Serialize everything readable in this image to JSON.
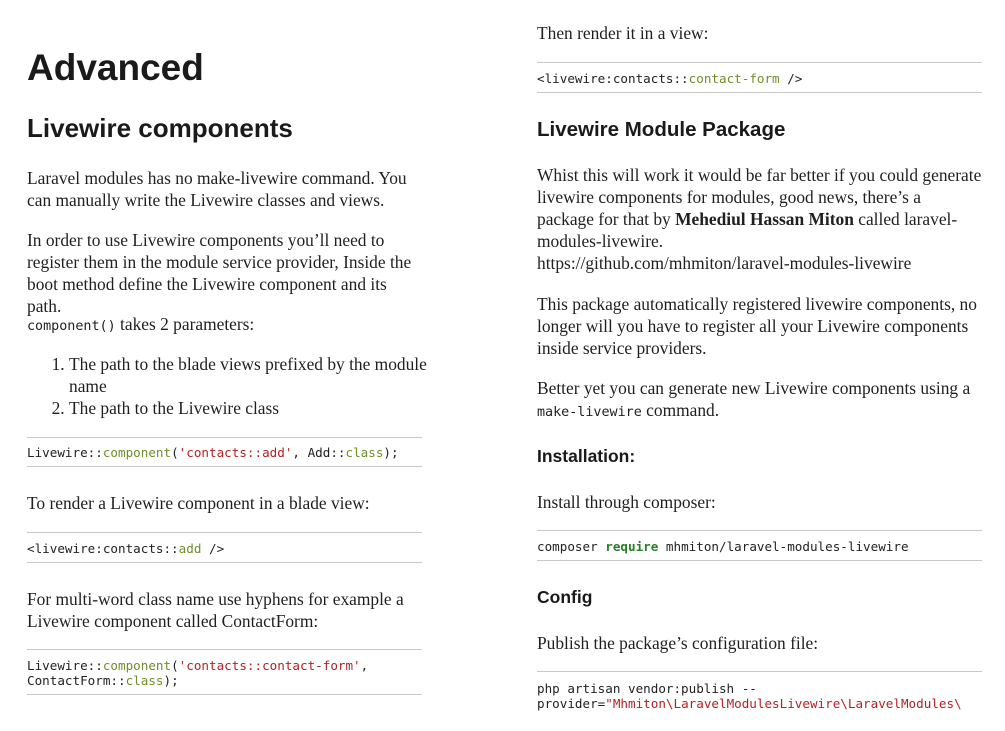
{
  "left": {
    "title": "Advanced",
    "subtitle": "Livewire components",
    "p1": "Laravel modules has no make-livewire command. You can manually write the Livewire classes and views.",
    "p2": "In order to use Livewire components you’ll need to register them in the module service provider, Inside the boot method define the Livewire component and its path.",
    "p3_code": "component()",
    "p3_text": " takes 2 parameters:",
    "list": [
      "The path to the blade views prefixed by the module name",
      "The path to the Livewire class"
    ],
    "code1": {
      "a": "Livewire::",
      "fn": "component",
      "b": "(",
      "str": "'contacts::add'",
      "c": ", Add::",
      "fn2": "class",
      "d": ");"
    },
    "p4": "To render a Livewire component in a blade view:",
    "code2": {
      "a": "<livewire:contacts::",
      "fn": "add",
      "b": " />"
    },
    "p5": "For multi-word class name use hyphens for example a Livewire component called ContactForm:",
    "code3": {
      "a": "Livewire::",
      "fn": "component",
      "b": "(",
      "str": "'contacts::contact-form'",
      "c": ",",
      "line2a": "ContactForm::",
      "fn2": "class",
      "d": ");"
    }
  },
  "right": {
    "p1": "Then render it in a view:",
    "code1": {
      "a": "<livewire:contacts::",
      "fn": "contact-form",
      "b": " />"
    },
    "heading1": "Livewire Module Package",
    "p2_a": "Whist this will work it would be far better if you could generate livewire components for modules, good news, there’s a package for that by ",
    "p2_bold": "Mehediul Hassan Miton",
    "p2_b": " called laravel-modules-livewire.",
    "p2_link": "https://github.com/mhmiton/laravel-modules-livewire",
    "p3": "This package automatically registered livewire components, no longer will you have to register all your Livewire components inside service providers.",
    "p4_a": "Better yet you can generate new Livewire components using a ",
    "p4_code": "make-livewire",
    "p4_b": " command.",
    "heading2": "Installation:",
    "p5": "Install through composer:",
    "code2": {
      "a": "composer ",
      "kw": "require",
      "b": " mhmiton/laravel-modules-livewire"
    },
    "heading3": "Config",
    "p6": "Publish the package’s configuration file:",
    "code3": {
      "line1": "php artisan vendor:publish --",
      "a": "provider=",
      "str": "\"Mhmiton\\LaravelModulesLivewire\\LaravelModules\\"
    }
  }
}
